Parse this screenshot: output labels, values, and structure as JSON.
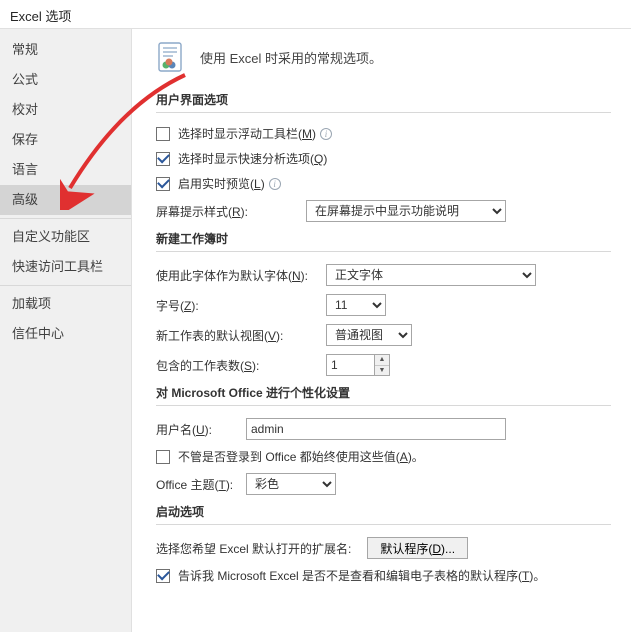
{
  "window": {
    "title": "Excel 选项"
  },
  "sidebar": {
    "items": [
      {
        "label": "常规"
      },
      {
        "label": "公式"
      },
      {
        "label": "校对"
      },
      {
        "label": "保存"
      },
      {
        "label": "语言"
      },
      {
        "label": "高级"
      },
      {
        "label": "自定义功能区"
      },
      {
        "label": "快速访问工具栏"
      },
      {
        "label": "加载项"
      },
      {
        "label": "信任中心"
      }
    ]
  },
  "header": {
    "text": "使用 Excel 时采用的常规选项。"
  },
  "section_ui": {
    "title": "用户界面选项",
    "cb_floating_pre": "选择时显示浮动工具栏(",
    "cb_floating_key": "M",
    "cb_floating_post": ")",
    "cb_quick_pre": "选择时显示快速分析选项(",
    "cb_quick_key": "Q",
    "cb_quick_post": ")",
    "cb_live_pre": "启用实时预览(",
    "cb_live_key": "L",
    "cb_live_post": ")",
    "tip_label_pre": "屏幕提示样式(",
    "tip_label_key": "R",
    "tip_label_post": "):",
    "tip_value": "在屏幕提示中显示功能说明"
  },
  "section_new": {
    "title": "新建工作簿时",
    "font_label_pre": "使用此字体作为默认字体(",
    "font_label_key": "N",
    "font_label_post": "):",
    "font_value": "正文字体",
    "size_label_pre": "字号(",
    "size_label_key": "Z",
    "size_label_post": "):",
    "size_value": "11",
    "view_label_pre": "新工作表的默认视图(",
    "view_label_key": "V",
    "view_label_post": "):",
    "view_value": "普通视图",
    "sheets_label_pre": "包含的工作表数(",
    "sheets_label_key": "S",
    "sheets_label_post": "):",
    "sheets_value": "1"
  },
  "section_pers": {
    "title": "对 Microsoft Office 进行个性化设置",
    "user_label_pre": "用户名(",
    "user_label_key": "U",
    "user_label_post": "):",
    "user_value": "admin",
    "always_pre": "不管是否登录到 Office 都始终使用这些值(",
    "always_key": "A",
    "always_post": ")。",
    "theme_label_pre": "Office 主题(",
    "theme_label_key": "T",
    "theme_label_post": "):",
    "theme_value": "彩色"
  },
  "section_start": {
    "title": "启动选项",
    "ext_label": "选择您希望 Excel 默认打开的扩展名:",
    "ext_btn_pre": "默认程序(",
    "ext_btn_key": "D",
    "ext_btn_post": ")...",
    "tell_pre": "告诉我 Microsoft Excel 是否不是查看和编辑电子表格的默认程序(",
    "tell_key": "T",
    "tell_post": ")。"
  }
}
